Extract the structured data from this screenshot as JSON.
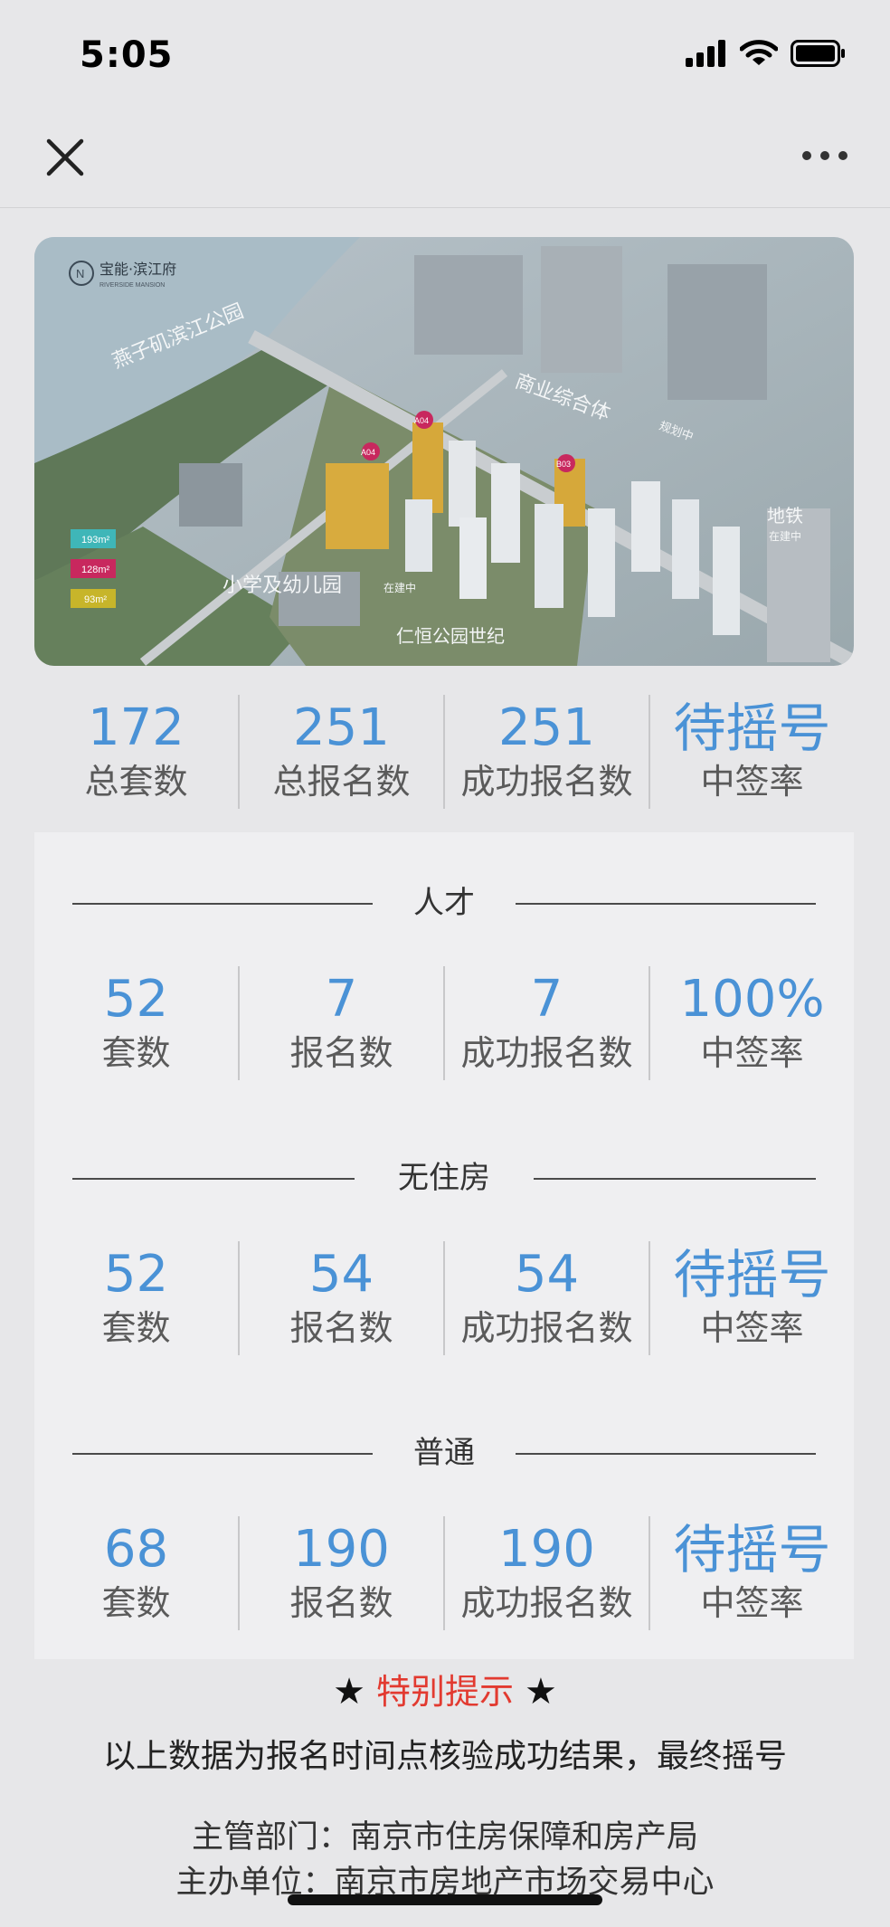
{
  "status_bar": {
    "time": "5:05"
  },
  "hero": {
    "brand": "宝能·滨江府",
    "brand_en": "RIVERSIDE MANSION",
    "labels": {
      "park": "燕子矶滨江公园",
      "commercial": "商业综合体",
      "commercial_note": "规划中",
      "metro": "地铁",
      "metro_note": "在建中",
      "school": "小学及幼儿园",
      "school_note": "在建中",
      "century_park": "仁恒公园世纪",
      "plots": [
        "A04",
        "A04",
        "B03"
      ]
    },
    "legend": [
      {
        "label": "193m²",
        "color": "#3fb6b8"
      },
      {
        "label": "128m²",
        "color": "#c8285e"
      },
      {
        "label": "93m²",
        "color": "#c7b52a"
      }
    ]
  },
  "summary": [
    {
      "value": "172",
      "label": "总套数"
    },
    {
      "value": "251",
      "label": "总报名数"
    },
    {
      "value": "251",
      "label": "成功报名数"
    },
    {
      "value": "待摇号",
      "label": "中签率"
    }
  ],
  "sections": [
    {
      "title": "人才",
      "stats": [
        {
          "value": "52",
          "label": "套数"
        },
        {
          "value": "7",
          "label": "报名数"
        },
        {
          "value": "7",
          "label": "成功报名数"
        },
        {
          "value": "100%",
          "label": "中签率"
        }
      ]
    },
    {
      "title": "无住房",
      "stats": [
        {
          "value": "52",
          "label": "套数"
        },
        {
          "value": "54",
          "label": "报名数"
        },
        {
          "value": "54",
          "label": "成功报名数"
        },
        {
          "value": "待摇号",
          "label": "中签率"
        }
      ]
    },
    {
      "title": "普通",
      "stats": [
        {
          "value": "68",
          "label": "套数"
        },
        {
          "value": "190",
          "label": "报名数"
        },
        {
          "value": "190",
          "label": "成功报名数"
        },
        {
          "value": "待摇号",
          "label": "中签率"
        }
      ]
    }
  ],
  "notice": {
    "star": "★",
    "title": "特别提示",
    "text": "以上数据为报名时间点核验成功结果，最终摇号"
  },
  "footer": {
    "dept": "主管部门：南京市住房保障和房产局",
    "org": "主办单位：南京市房地产市场交易中心"
  },
  "colors": {
    "accent": "#4a92d6",
    "alert": "#e23a30",
    "background": "#e7e7e9"
  }
}
